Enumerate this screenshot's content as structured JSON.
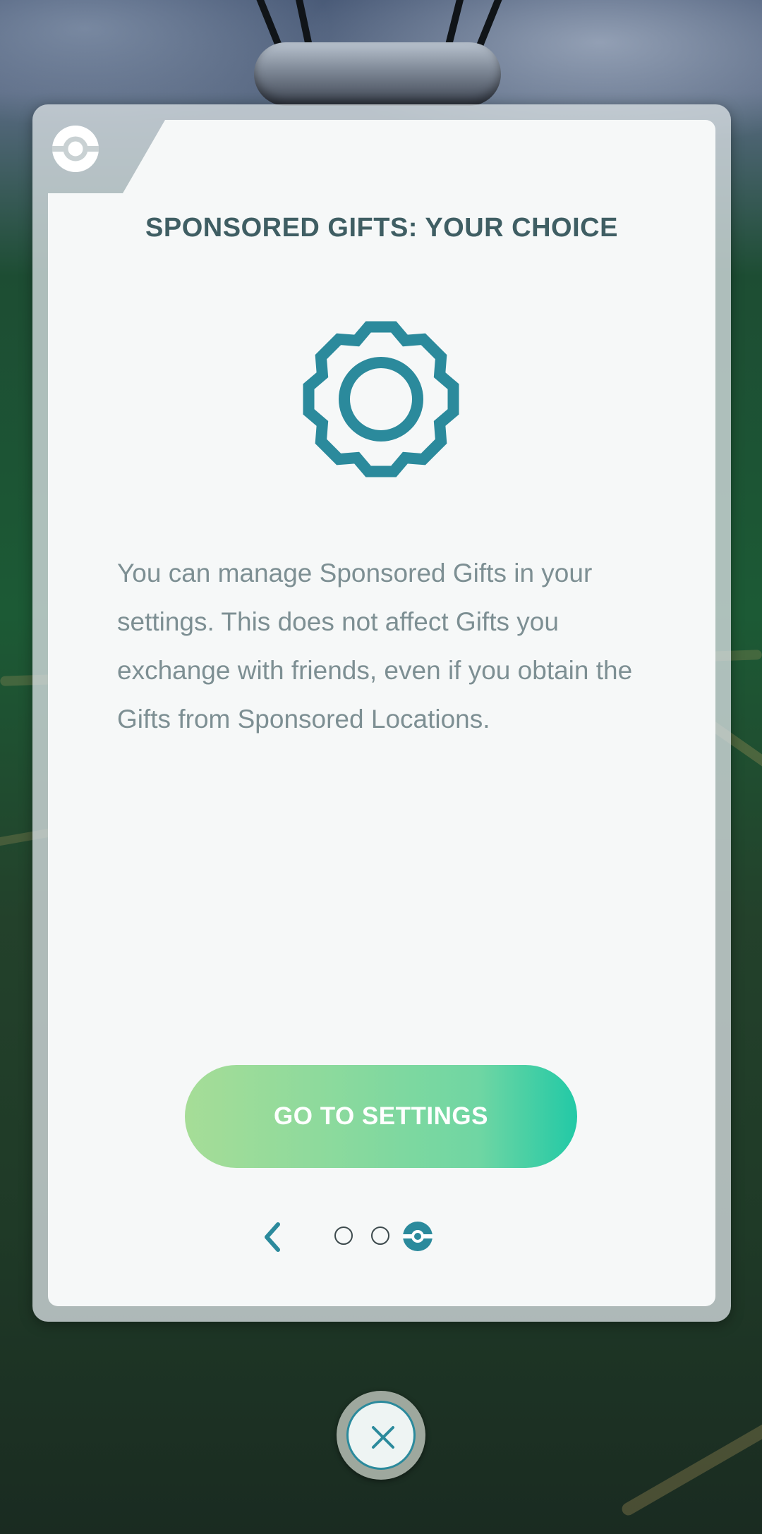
{
  "dialog": {
    "title": "SPONSORED GIFTS: YOUR CHOICE",
    "icon": "gear-icon",
    "body": "You can manage Sponsored Gifts in your settings. This does not affect Gifts you exchange with friends, even if you obtain the Gifts from Sponsored Locations.",
    "primary_button": "GO TO SETTINGS",
    "pagination": {
      "total_pages": 3,
      "current_page": 3
    },
    "back_icon": "chevron-left-icon",
    "header_badge_icon": "pokeball-icon"
  },
  "close_button": {
    "icon": "close-icon"
  },
  "colors": {
    "accent_teal": "#2b8a9c",
    "title_text": "#3f5e63",
    "body_text": "#7d8f93",
    "button_gradient_start": "#a6dd97",
    "button_gradient_end": "#22c9a6"
  }
}
